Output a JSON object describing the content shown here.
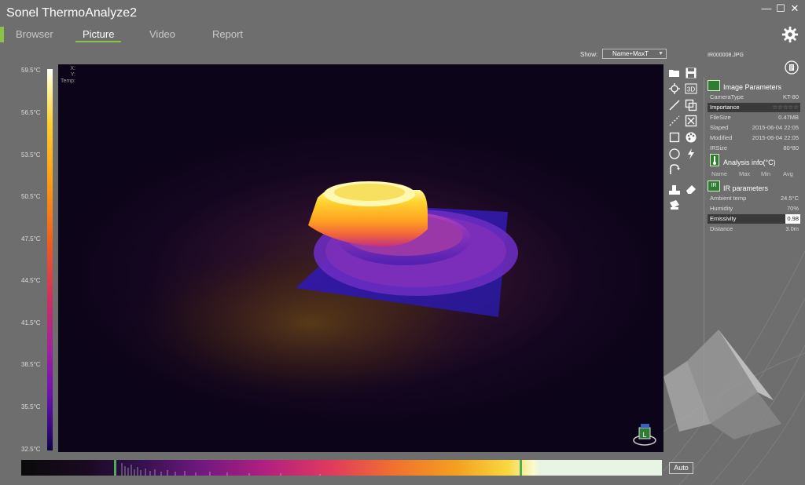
{
  "app": {
    "title": "Sonel ThermoAnalyze2"
  },
  "window_controls": {
    "minimize": "—",
    "maximize": "☐",
    "close": "✕"
  },
  "tabs": [
    {
      "label": "Browser",
      "active": false
    },
    {
      "label": "Picture",
      "active": true
    },
    {
      "label": "Video",
      "active": false
    },
    {
      "label": "Report",
      "active": false
    }
  ],
  "show": {
    "label": "Show:",
    "value": "Name+MaxT"
  },
  "scale": {
    "labels": [
      "59.5°C",
      "56.5°C",
      "53.5°C",
      "50.5°C",
      "47.5°C",
      "44.5°C",
      "41.5°C",
      "38.5°C",
      "35.5°C",
      "32.5°C"
    ]
  },
  "coords": {
    "x": "X:",
    "y": "Y:",
    "temp": "Temp:"
  },
  "view_cube_label": "L",
  "file": {
    "name": "IR000008.JPG"
  },
  "image_parameters": {
    "title": "Image Parameters",
    "rows": [
      {
        "key": "CameraType",
        "value": "KT-80"
      },
      {
        "key": "Importance",
        "value": "☆☆☆☆☆"
      },
      {
        "key": "FileSize",
        "value": "0.47MB"
      },
      {
        "key": "Slaped",
        "value": "2015-06-04 22:05"
      },
      {
        "key": "Modified",
        "value": "2015-06-04 22:05"
      },
      {
        "key": "IRSize",
        "value": "80*80"
      }
    ]
  },
  "analysis_info": {
    "title": "Analysis info(°C)",
    "columns": [
      "Name",
      "Max",
      "Min",
      "Avg"
    ]
  },
  "ir_parameters": {
    "title": "IR parameters",
    "icon_text": "IR",
    "rows": [
      {
        "key": "Ambient temp",
        "value": "24.5°C"
      },
      {
        "key": "Humidity",
        "value": "70%"
      },
      {
        "key": "Emissivity",
        "value": "0.98"
      },
      {
        "key": "Distance",
        "value": "3.0m"
      }
    ]
  },
  "histogram": {
    "auto_label": "Auto"
  },
  "colors": {
    "accent": "#8bc34a",
    "background": "#6e6e6e",
    "section_icon": "#2e7d32"
  }
}
